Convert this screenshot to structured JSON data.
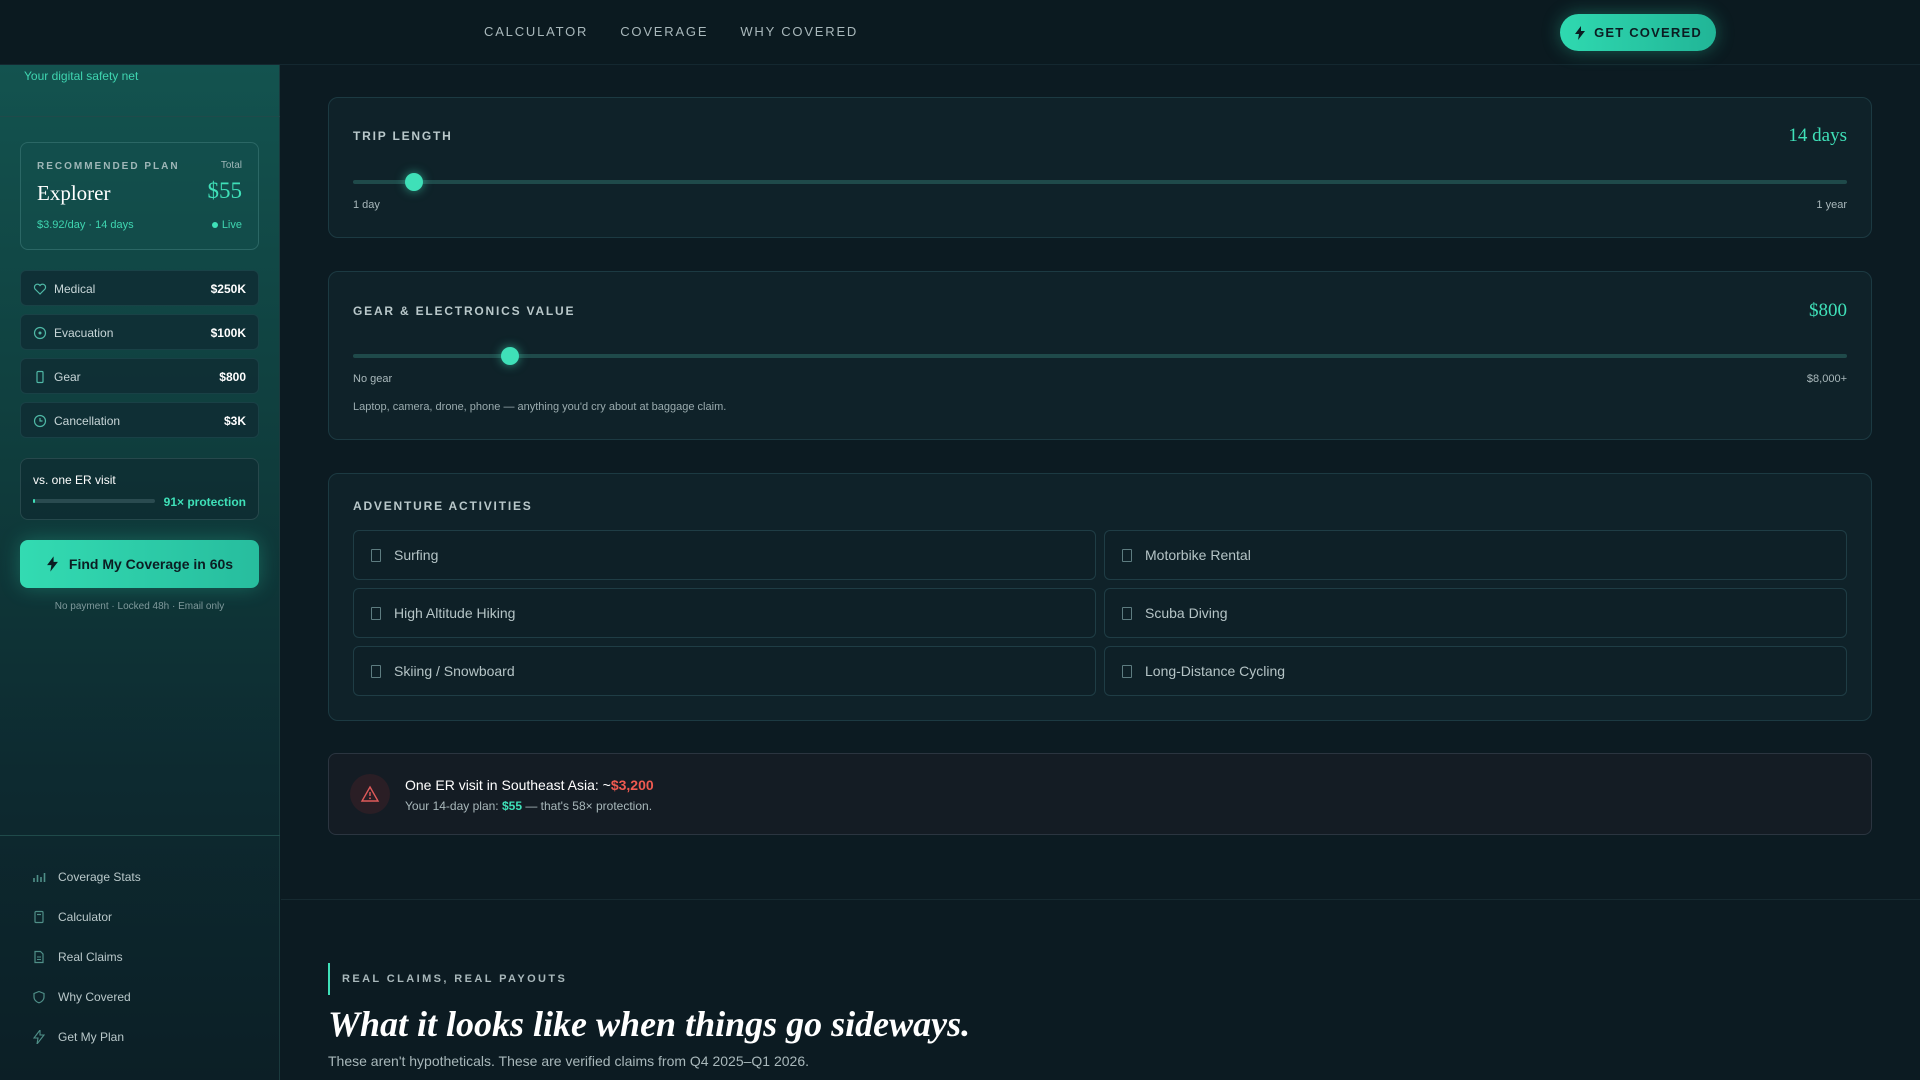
{
  "topnav": {
    "links": [
      "CALCULATOR",
      "COVERAGE",
      "WHY COVERED"
    ],
    "cta": "GET COVERED"
  },
  "sidebar": {
    "tagline": "Your digital safety net",
    "plan": {
      "kicker": "RECOMMENDED PLAN",
      "total_label": "Total",
      "name": "Explorer",
      "price": "$55",
      "rate": "$3.92/day · 14 days",
      "live": "Live"
    },
    "coverage": [
      {
        "label": "Medical",
        "value": "$250K",
        "icon": "heart-icon"
      },
      {
        "label": "Evacuation",
        "value": "$100K",
        "icon": "compass-icon"
      },
      {
        "label": "Gear",
        "value": "$800",
        "icon": "phone-icon"
      },
      {
        "label": "Cancellation",
        "value": "$3K",
        "icon": "clock-icon"
      }
    ],
    "er_card": {
      "title": "vs. one ER visit",
      "protection": "91× protection",
      "bar_fill": 0.02
    },
    "find_button": "Find My Coverage in 60s",
    "find_note": "No payment · Locked 48h · Email only",
    "nav": [
      {
        "label": "Coverage Stats",
        "icon": "bar-chart-icon"
      },
      {
        "label": "Calculator",
        "icon": "calculator-icon"
      },
      {
        "label": "Real Claims",
        "icon": "document-icon"
      },
      {
        "label": "Why Covered",
        "icon": "shield-icon"
      },
      {
        "label": "Get My Plan",
        "icon": "bolt-icon"
      }
    ]
  },
  "trip": {
    "title": "TRIP LENGTH",
    "value": "14 days",
    "min_label": "1 day",
    "max_label": "1 year",
    "slider_fraction": 0.041
  },
  "gear": {
    "title": "GEAR & ELECTRONICS VALUE",
    "value": "$800",
    "min_label": "No gear",
    "max_label": "$8,000+",
    "hint": "Laptop, camera, drone, phone — anything you'd cry about at baggage claim.",
    "slider_fraction": 0.105
  },
  "activities": {
    "title": "ADVENTURE ACTIVITIES",
    "items": [
      "Surfing",
      "Motorbike Rental",
      "High Altitude Hiking",
      "Scuba Diving",
      "Skiing / Snowboard",
      "Long-Distance Cycling"
    ]
  },
  "alert": {
    "line1_prefix": "One ER visit in Southeast Asia: ~",
    "line1_amount": "$3,200",
    "line2_prefix": "Your 14-day plan: ",
    "line2_amount": "$55",
    "line2_suffix": " — that's 58× protection."
  },
  "claims": {
    "kicker": "REAL CLAIMS, REAL PAYOUTS",
    "title": "What it looks like when things go sideways.",
    "subtitle": "These aren't hypotheticals. These are verified claims from Q4 2025–Q1 2026."
  }
}
